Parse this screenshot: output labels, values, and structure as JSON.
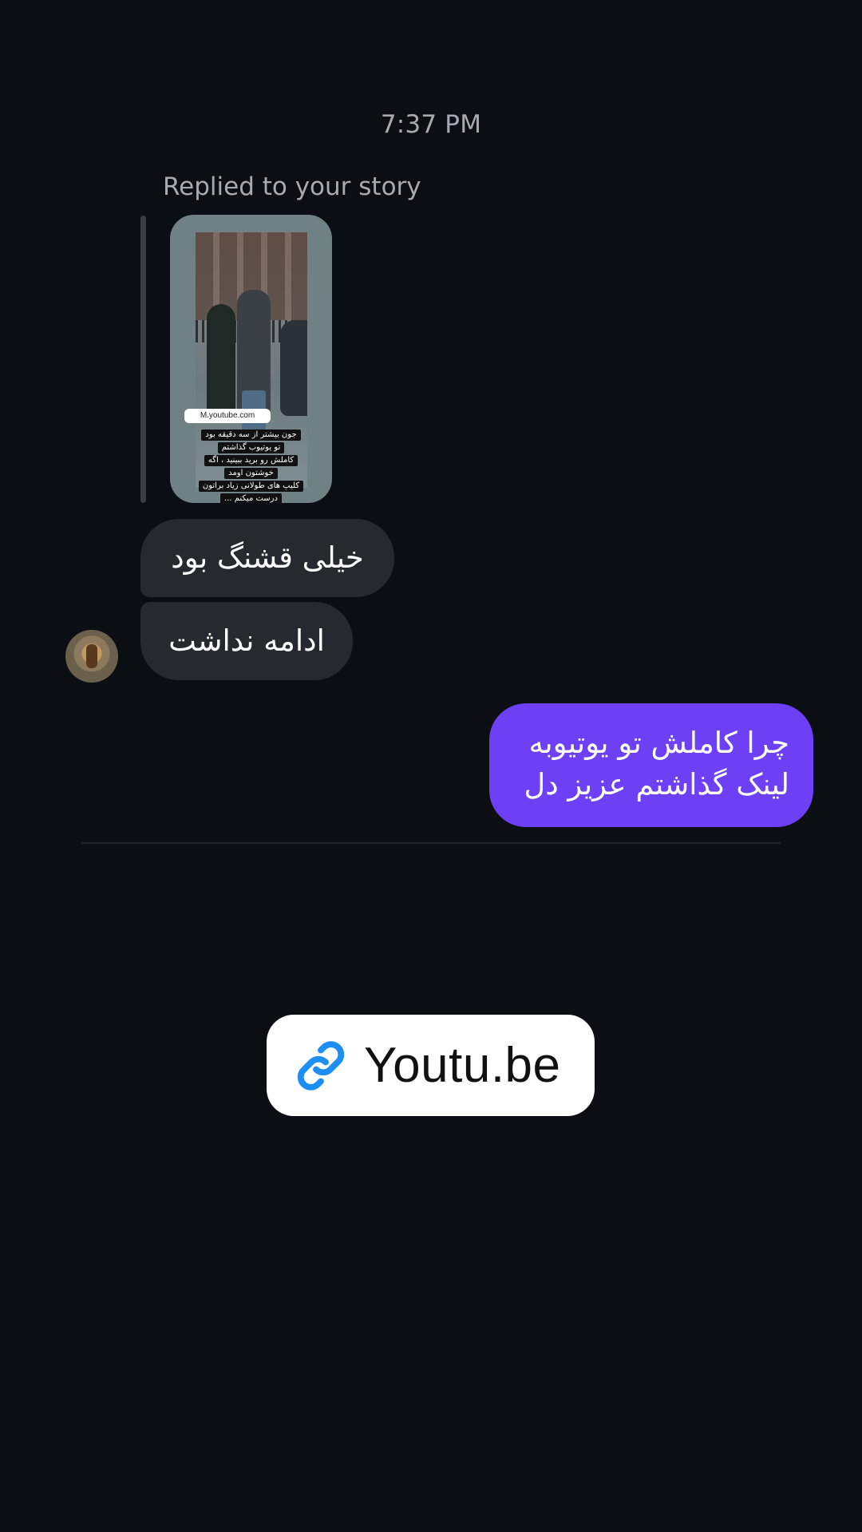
{
  "thread": {
    "timestamp": "7:37 PM",
    "reply_label": "Replied to your story"
  },
  "story": {
    "link_sticker": "M.youtube.com",
    "caption_lines": [
      "جون بیشتر از سه دقیقه بود",
      "تو یوتیوب گذاشتم",
      "کاملش رو برید ببینید ، اگه",
      "خوشتون اومد",
      "کلیپ های طولانی زیاد براتون",
      "درست میکنم ..."
    ]
  },
  "messages": {
    "incoming": [
      "خیلی قشنگ بود",
      "ادامه نداشت"
    ],
    "outgoing": {
      "line1": "چرا کاملش تو یوتیوبه",
      "line2": "لینک گذاشتم عزیز دل"
    }
  },
  "link_sticker": {
    "icon": "link-icon",
    "text": "Youtu.be"
  },
  "colors": {
    "background": "#0b0f14",
    "incoming_bubble": "#26292e",
    "outgoing_bubble": "#6d3ff5",
    "link_icon": "#1d8ff2"
  }
}
